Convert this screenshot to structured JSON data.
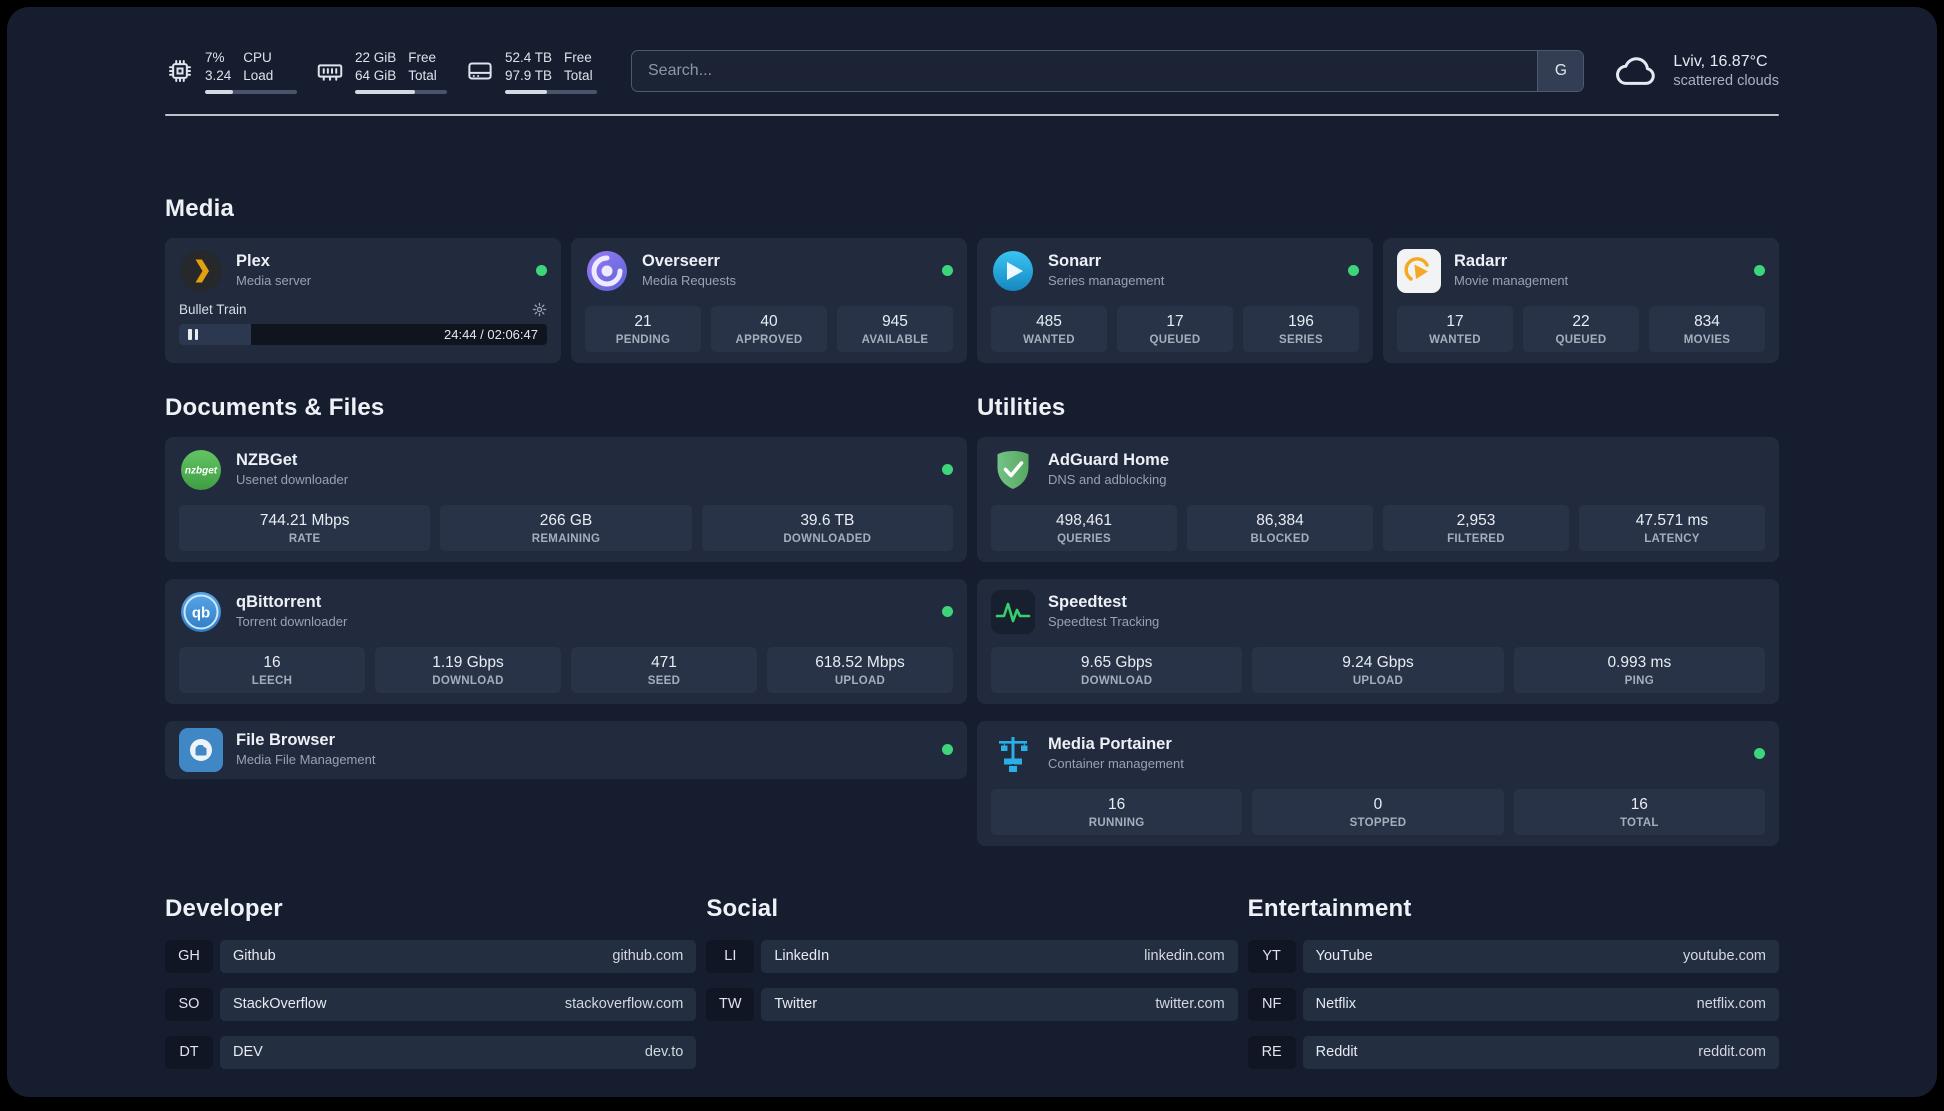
{
  "topbar": {
    "resources": [
      {
        "value_top": "7%",
        "value_bottom": "3.24",
        "label_top": "CPU",
        "label_bottom": "Load",
        "percent": 30
      },
      {
        "value_top": "22 GiB",
        "value_bottom": "64 GiB",
        "label_top": "Free",
        "label_bottom": "Total",
        "percent": 65
      },
      {
        "value_top": "52.4 TB",
        "value_bottom": "97.9 TB",
        "label_top": "Free",
        "label_bottom": "Total",
        "percent": 46
      }
    ],
    "search": {
      "placeholder": "Search...",
      "provider_label": "G"
    },
    "weather": {
      "location": "Lviv, 16.87°C",
      "condition": "scattered clouds"
    }
  },
  "sections": {
    "media": {
      "title": "Media",
      "cards": [
        {
          "name": "Plex",
          "subtitle": "Media server",
          "status": "online",
          "player": {
            "track": "Bullet Train",
            "time": "24:44 / 02:06:47",
            "percent": 19.5
          }
        },
        {
          "name": "Overseerr",
          "subtitle": "Media Requests",
          "status": "online",
          "stats": [
            {
              "value": "21",
              "label": "PENDING"
            },
            {
              "value": "40",
              "label": "APPROVED"
            },
            {
              "value": "945",
              "label": "AVAILABLE"
            }
          ]
        },
        {
          "name": "Sonarr",
          "subtitle": "Series management",
          "status": "online",
          "stats": [
            {
              "value": "485",
              "label": "WANTED"
            },
            {
              "value": "17",
              "label": "QUEUED"
            },
            {
              "value": "196",
              "label": "SERIES"
            }
          ]
        },
        {
          "name": "Radarr",
          "subtitle": "Movie management",
          "status": "online",
          "stats": [
            {
              "value": "17",
              "label": "WANTED"
            },
            {
              "value": "22",
              "label": "QUEUED"
            },
            {
              "value": "834",
              "label": "MOVIES"
            }
          ]
        }
      ]
    },
    "documents": {
      "title": "Documents & Files",
      "cards": [
        {
          "name": "NZBGet",
          "subtitle": "Usenet downloader",
          "status": "online",
          "stats": [
            {
              "value": "744.21 Mbps",
              "label": "RATE"
            },
            {
              "value": "266 GB",
              "label": "REMAINING"
            },
            {
              "value": "39.6 TB",
              "label": "DOWNLOADED"
            }
          ]
        },
        {
          "name": "qBittorrent",
          "subtitle": "Torrent downloader",
          "status": "online",
          "stats": [
            {
              "value": "16",
              "label": "LEECH"
            },
            {
              "value": "1.19 Gbps",
              "label": "DOWNLOAD"
            },
            {
              "value": "471",
              "label": "SEED"
            },
            {
              "value": "618.52 Mbps",
              "label": "UPLOAD"
            }
          ]
        },
        {
          "name": "File Browser",
          "subtitle": "Media File Management",
          "status": "online"
        }
      ]
    },
    "utilities": {
      "title": "Utilities",
      "cards": [
        {
          "name": "AdGuard Home",
          "subtitle": "DNS and adblocking",
          "stats": [
            {
              "value": "498,461",
              "label": "QUERIES"
            },
            {
              "value": "86,384",
              "label": "BLOCKED"
            },
            {
              "value": "2,953",
              "label": "FILTERED"
            },
            {
              "value": "47.571 ms",
              "label": "LATENCY"
            }
          ]
        },
        {
          "name": "Speedtest",
          "subtitle": "Speedtest Tracking",
          "stats": [
            {
              "value": "9.65 Gbps",
              "label": "DOWNLOAD"
            },
            {
              "value": "9.24 Gbps",
              "label": "UPLOAD"
            },
            {
              "value": "0.993 ms",
              "label": "PING"
            }
          ]
        },
        {
          "name": "Media Portainer",
          "subtitle": "Container management",
          "status": "online",
          "stats": [
            {
              "value": "16",
              "label": "RUNNING"
            },
            {
              "value": "0",
              "label": "STOPPED"
            },
            {
              "value": "16",
              "label": "TOTAL"
            }
          ]
        }
      ]
    }
  },
  "bookmarks": {
    "groups": [
      {
        "title": "Developer",
        "items": [
          {
            "abbr": "GH",
            "name": "Github",
            "url": "github.com"
          },
          {
            "abbr": "SO",
            "name": "StackOverflow",
            "url": "stackoverflow.com"
          },
          {
            "abbr": "DT",
            "name": "DEV",
            "url": "dev.to"
          }
        ]
      },
      {
        "title": "Social",
        "items": [
          {
            "abbr": "LI",
            "name": "LinkedIn",
            "url": "linkedin.com"
          },
          {
            "abbr": "TW",
            "name": "Twitter",
            "url": "twitter.com"
          }
        ]
      },
      {
        "title": "Entertainment",
        "items": [
          {
            "abbr": "YT",
            "name": "YouTube",
            "url": "youtube.com"
          },
          {
            "abbr": "NF",
            "name": "Netflix",
            "url": "netflix.com"
          },
          {
            "abbr": "RE",
            "name": "Reddit",
            "url": "reddit.com"
          }
        ]
      }
    ]
  },
  "colors": {
    "status_online": "#3dd47a",
    "plex_amber": "#e5a00d",
    "background": "#161d2f",
    "card": "#212b3d"
  }
}
